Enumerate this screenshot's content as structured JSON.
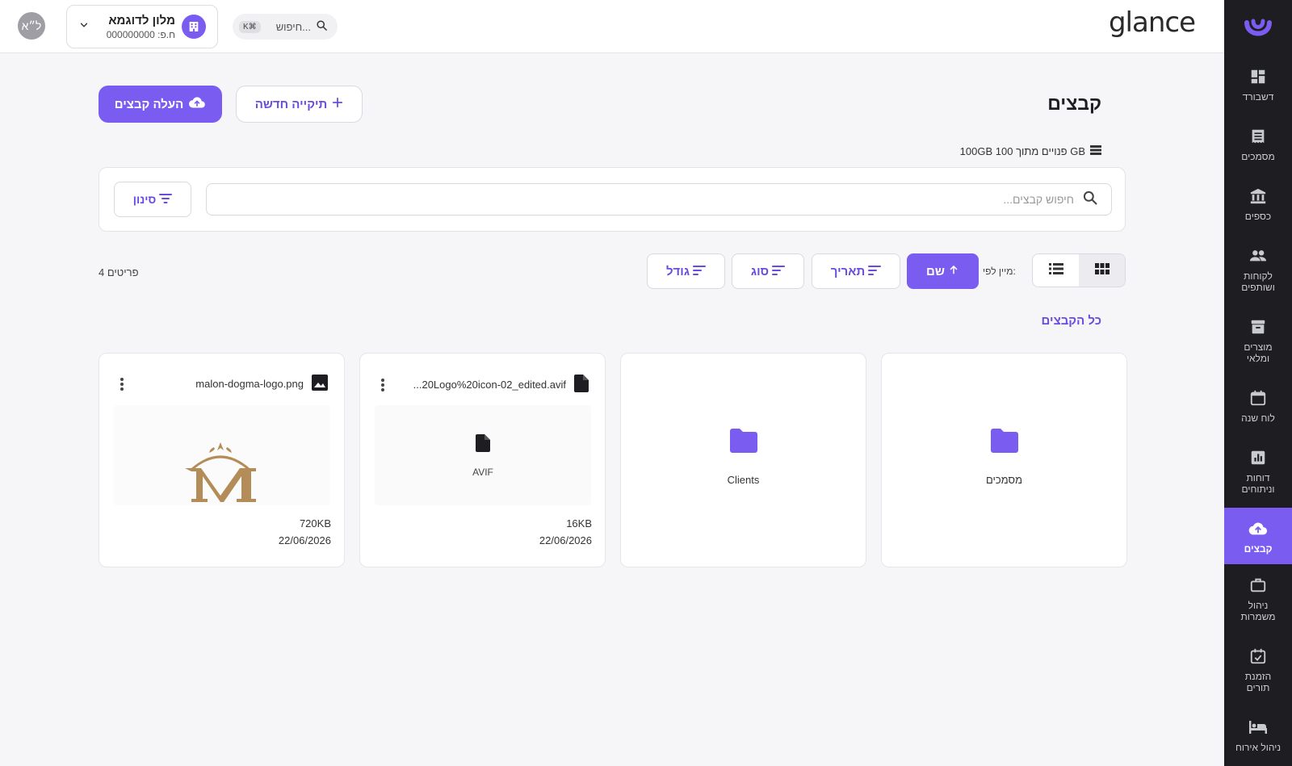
{
  "colors": {
    "accent": "#7b5cf0",
    "sidebar_bg": "#1d1d22",
    "page_bg": "#f6f6f8",
    "logo_gold": "#b38c57"
  },
  "header": {
    "brand": "glance",
    "avatar_initials": "ל״א",
    "org": {
      "name": "מלון לדוגמא",
      "sub": "ח.פ: 000000000",
      "icon": "building-icon"
    },
    "search": {
      "label": "חיפוש...",
      "shortcut": "K⌘"
    }
  },
  "sidebar": {
    "items": [
      {
        "label": "דשבורד",
        "icon": "dashboard-icon"
      },
      {
        "label": "מסמכים",
        "icon": "documents-icon"
      },
      {
        "label": "כספים",
        "icon": "bank-icon"
      },
      {
        "label": "לקוחות ושותפים",
        "icon": "people-icon"
      },
      {
        "label": "מוצרים ומלאי",
        "icon": "archive-icon"
      },
      {
        "label": "לוח שנה",
        "icon": "calendar-icon"
      },
      {
        "label": "דוחות וניתוחים",
        "icon": "report-icon"
      },
      {
        "label": "קבצים",
        "icon": "cloud-upload-icon",
        "active": true
      },
      {
        "label": "ניהול משמרות",
        "icon": "briefcase-icon"
      },
      {
        "label": "הזמנת תורים",
        "icon": "calendar-check-icon"
      },
      {
        "label": "ניהול אירוח",
        "icon": "bed-icon"
      }
    ]
  },
  "main": {
    "title": "קבצים",
    "upload_label": "העלה קבצים",
    "new_folder_label": "תיקייה חדשה",
    "storage": "100GB פנויים מתוך 100 GB",
    "search_placeholder": "חיפוש קבצים...",
    "filter_label": "סינון",
    "sort_label": "מיין לפי:",
    "sort": [
      {
        "label": "שם",
        "active": true
      },
      {
        "label": "תאריך"
      },
      {
        "label": "סוג"
      },
      {
        "label": "גודל"
      }
    ],
    "count": "4 פריטים",
    "section": "כל הקבצים",
    "folders": [
      {
        "name": "מסמכים"
      },
      {
        "name": "Clients"
      }
    ],
    "files": [
      {
        "name": "...20Logo%20icon-02_edited.avif",
        "type": "AVIF",
        "size": "16KB",
        "date": "22/06/2026",
        "icon": "file-icon"
      },
      {
        "name": "malon-dogma-logo.png",
        "size": "720KB",
        "date": "22/06/2026",
        "icon": "image-icon"
      }
    ]
  }
}
